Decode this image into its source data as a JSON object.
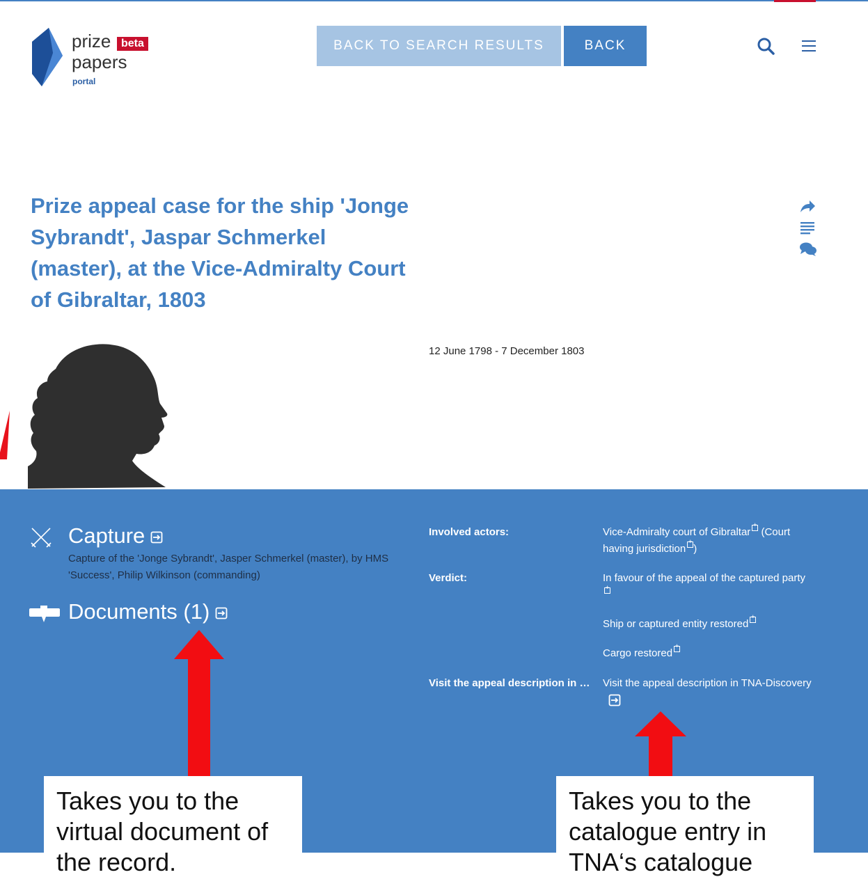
{
  "logo": {
    "prize": "prize",
    "beta": "beta",
    "papers": "papers",
    "portal": "portal"
  },
  "header": {
    "back_to_search_results": "BACK TO SEARCH RESULTS",
    "back": "BACK"
  },
  "record": {
    "title": "Prize appeal case for the ship 'Jonge Sybrandt', Jaspar Schmerkel (master), at the Vice-Admiralty Court of Gibraltar, 1803",
    "date_range": "12 June 1798 - 7 December 1803"
  },
  "capture": {
    "title": "Capture",
    "description": "Capture of the 'Jonge Sybrandt', Jasper Schmerkel (master), by HMS 'Success', Philip Wilkinson (commanding)"
  },
  "documents": {
    "title": "Documents (1)"
  },
  "metadata": {
    "involved_actors_label": "Involved actors:",
    "involved_actors_value_a": "Vice-Admiralty court of Gibraltar",
    "involved_actors_value_b": "(Court having jurisdiction",
    "involved_actors_value_c": ")",
    "verdict_label": "Verdict:",
    "verdict_1": "In favour of the appeal of the captured party",
    "verdict_2": "Ship or captured entity restored",
    "verdict_3": "Cargo restored",
    "visit_label": "Visit the appeal description in TNA-Discovery",
    "visit_value": "Visit the appeal description in TNA-Discovery"
  },
  "annotations": {
    "left_note": "Takes you to the virtual document of the record.",
    "right_note": "Takes you to the catalogue entry in TNA‘s catalogue"
  },
  "colors": {
    "brand_blue": "#4481c3",
    "light_blue": "#a6c4e3",
    "red": "#c8102e"
  }
}
